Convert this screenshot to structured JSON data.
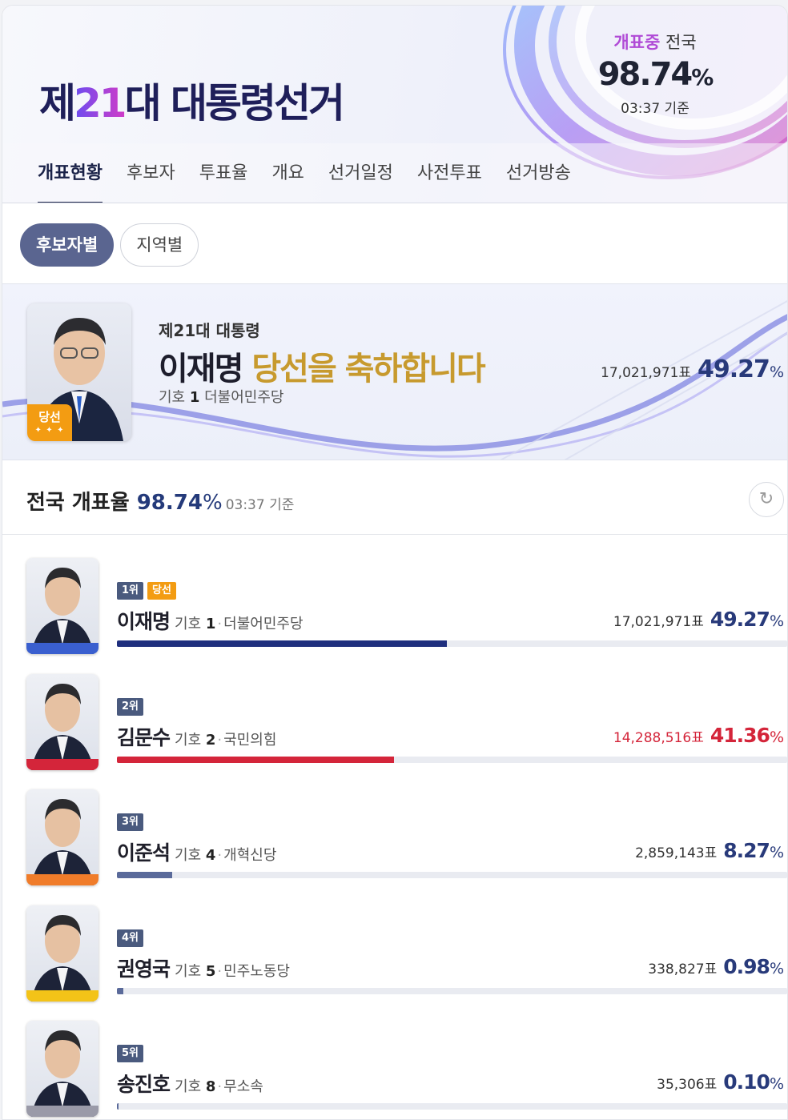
{
  "header": {
    "title_prefix": "제",
    "title_number": "21",
    "title_suffix": "대 대통령선거",
    "count_status": "개표중",
    "count_scope": "전국",
    "count_value": "98.74",
    "count_unit": "%",
    "count_time": "03:37 기준"
  },
  "tabs": [
    {
      "label": "개표현황",
      "active": true
    },
    {
      "label": "후보자"
    },
    {
      "label": "투표율"
    },
    {
      "label": "개요"
    },
    {
      "label": "선거일정"
    },
    {
      "label": "사전투표"
    },
    {
      "label": "선거방송"
    }
  ],
  "filters": {
    "by_candidate": "후보자별",
    "by_region": "지역별",
    "active": "by_candidate"
  },
  "winner": {
    "subtitle": "제21대 대통령",
    "name": "이재명",
    "message": "당선을 축하합니다",
    "number_label": "기호",
    "number": "1",
    "party": "더불어민주당",
    "badge": "당선",
    "votes": "17,021,971표",
    "percent": "49.27",
    "percent_unit": "%"
  },
  "national_rate": {
    "label": "전국 개표율",
    "value": "98.74",
    "unit": "%",
    "time": "03:37 기준"
  },
  "candidates": [
    {
      "rank": "1위",
      "elected": "당선",
      "name": "이재명",
      "number_label": "기호",
      "number": "1",
      "party": "더불어민주당",
      "votes": "17,021,971표",
      "percent": "49.27",
      "unit": "%",
      "share": 49.27,
      "color": "#1f2f7e",
      "stripe": "#3a5fcf"
    },
    {
      "rank": "2위",
      "elected": "",
      "name": "김문수",
      "number_label": "기호",
      "number": "2",
      "party": "국민의힘",
      "votes": "14,288,516표",
      "percent": "41.36",
      "unit": "%",
      "share": 41.36,
      "color": "#d4253a",
      "stripe": "#d4253a"
    },
    {
      "rank": "3위",
      "elected": "",
      "name": "이준석",
      "number_label": "기호",
      "number": "4",
      "party": "개혁신당",
      "votes": "2,859,143표",
      "percent": "8.27",
      "unit": "%",
      "share": 8.27,
      "color": "#5a6a9a",
      "stripe": "#f07c2a"
    },
    {
      "rank": "4위",
      "elected": "",
      "name": "권영국",
      "number_label": "기호",
      "number": "5",
      "party": "민주노동당",
      "votes": "338,827표",
      "percent": "0.98",
      "unit": "%",
      "share": 0.98,
      "color": "#5a6a9a",
      "stripe": "#f3c318"
    },
    {
      "rank": "5위",
      "elected": "",
      "name": "송진호",
      "number_label": "기호",
      "number": "8",
      "party": "무소속",
      "votes": "35,306표",
      "percent": "0.10",
      "unit": "%",
      "share": 0.1,
      "color": "#5a6a9a",
      "stripe": "#9a9aa8"
    }
  ],
  "colors": {
    "navy": "#1f2f7e",
    "red": "#d4253a",
    "gold": "#c79a2e",
    "orange": "#f39c12"
  }
}
